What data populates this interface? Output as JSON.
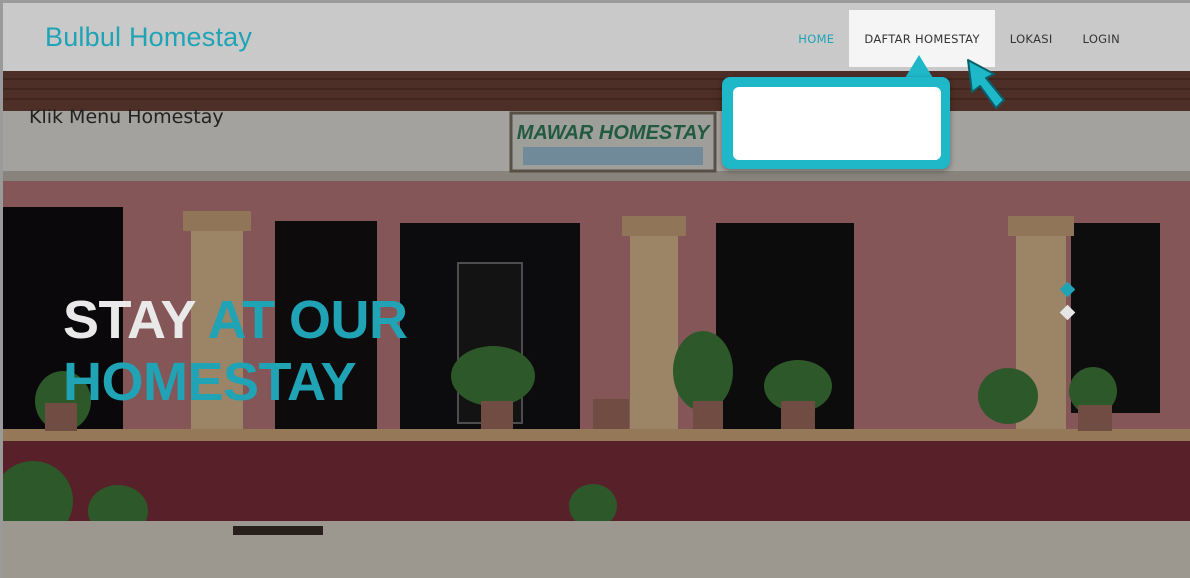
{
  "navbar": {
    "brand": "Bulbul Homestay",
    "items": [
      {
        "label": "HOME",
        "active": true
      },
      {
        "label": "DAFTAR HOMESTAY",
        "active": false
      },
      {
        "label": "LOKASI",
        "active": false
      },
      {
        "label": "LOGIN",
        "active": false
      }
    ]
  },
  "hero": {
    "title_part1": "STAY",
    "title_part2": "AT OUR",
    "title_part3": "HOMESTAY",
    "sign_name": "MAWAR HOMESTAY"
  },
  "callout": {
    "text": "Klik Menu Homestay"
  },
  "colors": {
    "accent": "#1fa3b5",
    "navbar_bg": "#c9c9c9",
    "callout": "#1fb8c9"
  },
  "icons": {
    "cursor": "pointer-arrow-icon",
    "slide_dots": "diamond-indicator-icon"
  }
}
